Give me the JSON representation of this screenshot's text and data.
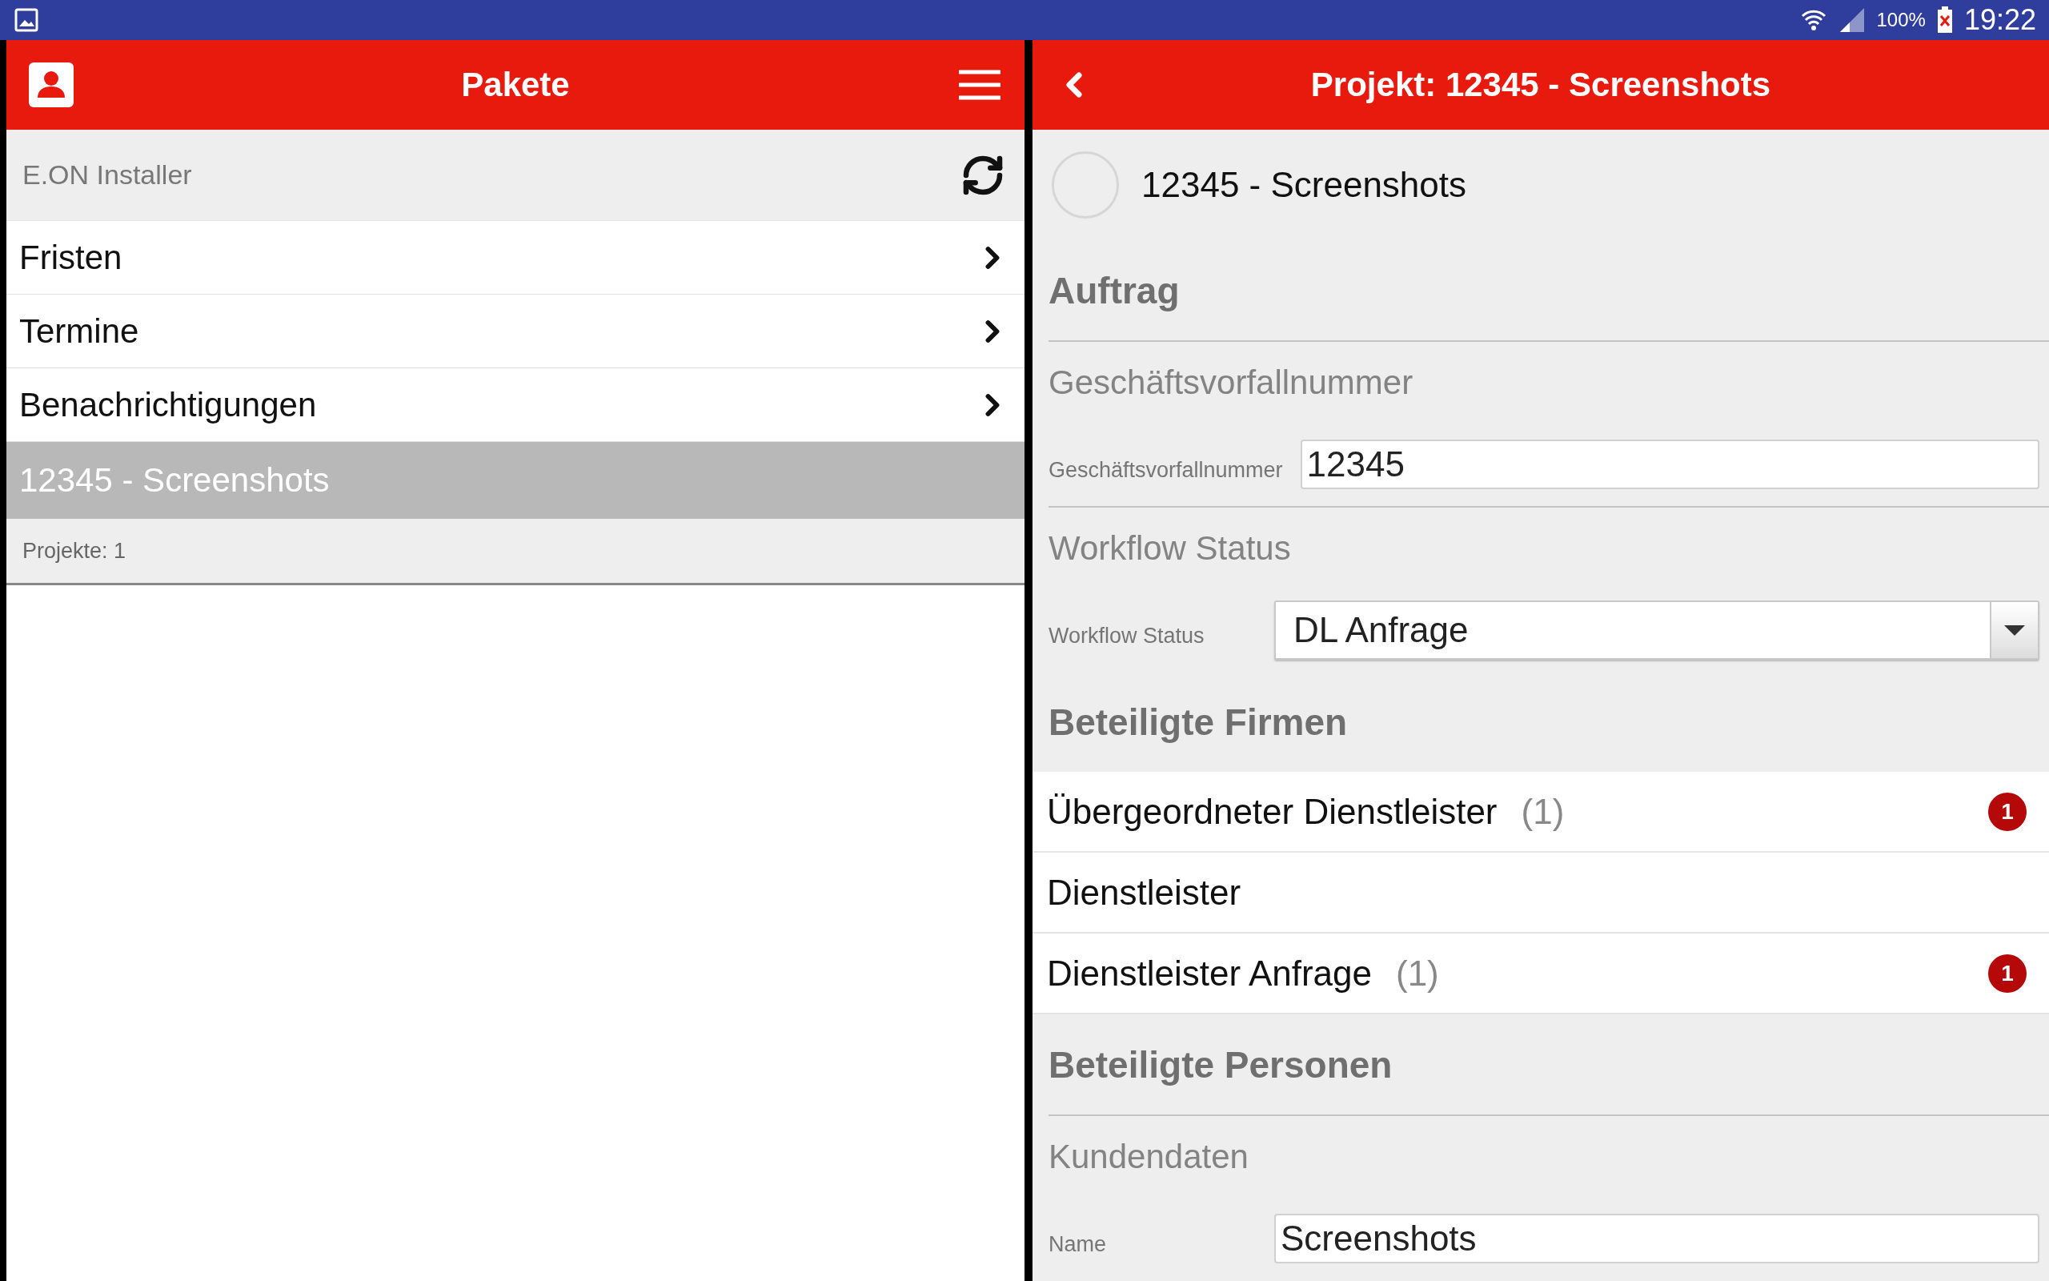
{
  "status_bar": {
    "battery": "100%",
    "time": "19:22"
  },
  "left": {
    "title": "Pakete",
    "account": "E.ON Installer",
    "items": [
      {
        "kind": "link",
        "label": "Fristen",
        "selected": false
      },
      {
        "kind": "link",
        "label": "Termine",
        "selected": false
      },
      {
        "kind": "link",
        "label": "Benachrichtigungen",
        "selected": false
      },
      {
        "kind": "project",
        "label": "12345 - Screenshots",
        "selected": true
      }
    ],
    "footer": "Projekte: 1"
  },
  "right": {
    "title": "Projekt: 12345 - Screenshots",
    "project": "12345 - Screenshots",
    "blocks": [
      {
        "kind": "heading",
        "text": "Auftrag"
      },
      {
        "kind": "subheading",
        "text": "Geschäftsvorfallnummer"
      },
      {
        "kind": "field",
        "label": "Geschäftsvorfallnummer",
        "value": "12345"
      },
      {
        "kind": "subheading",
        "text": "Workflow Status"
      },
      {
        "kind": "select",
        "label": "Workflow Status",
        "value": "DL Anfrage"
      },
      {
        "kind": "heading",
        "text": "Beteiligte Firmen"
      },
      {
        "kind": "link",
        "text": "Übergeordneter Dienstleister",
        "count": "(1)",
        "badge": "1"
      },
      {
        "kind": "link",
        "text": "Dienstleister"
      },
      {
        "kind": "link",
        "text": "Dienstleister Anfrage",
        "count": "(1)",
        "badge": "1"
      },
      {
        "kind": "heading",
        "text": "Beteiligte Personen"
      },
      {
        "kind": "subheading",
        "text": "Kundendaten"
      },
      {
        "kind": "field",
        "label": "Name",
        "value": "Screenshots"
      }
    ]
  }
}
